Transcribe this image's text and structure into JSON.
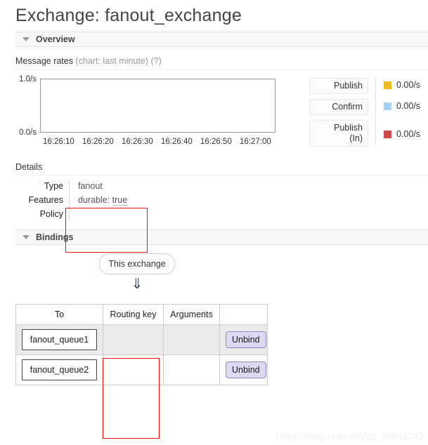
{
  "page": {
    "title": "Exchange: fanout_exchange",
    "watermark": "https://blog.csdn.net/qq_38846242"
  },
  "overview": {
    "heading": "Overview",
    "caret_icon": "caret-down-icon",
    "message_rates_label": "Message rates",
    "message_rates_note": "(chart: last minute)",
    "message_rates_help": "(?)"
  },
  "chart_data": {
    "type": "line",
    "title": "Message rates (chart: last minute)",
    "xlabel": "",
    "ylabel": "",
    "ylim": [
      0.0,
      1.0
    ],
    "ytick_labels": [
      "1.0/s",
      "0.0/s"
    ],
    "ytick_values": [
      1.0,
      0.0
    ],
    "grid": false,
    "x": [
      "16:26:10",
      "16:26:20",
      "16:26:30",
      "16:26:40",
      "16:26:50",
      "16:27:00"
    ],
    "legend_position": "right",
    "series": [
      {
        "name": "Publish",
        "color": "#edbc25",
        "rate": "0.00/s",
        "values": [
          0,
          0,
          0,
          0,
          0,
          0
        ]
      },
      {
        "name": "Confirm",
        "color": "#a5d2f0",
        "rate": "0.00/s",
        "values": [
          0,
          0,
          0,
          0,
          0,
          0
        ]
      },
      {
        "name": "Publish (In)",
        "color": "#cc4b4b",
        "rate": "0.00/s",
        "values": [
          0,
          0,
          0,
          0,
          0,
          0
        ]
      }
    ]
  },
  "rate_buttons": [
    {
      "label": "Publish"
    },
    {
      "label": "Confirm"
    },
    {
      "label": "Publish\n(In)",
      "line1": "Publish",
      "line2": "(In)"
    }
  ],
  "details": {
    "label": "Details",
    "rows": [
      {
        "name": "Type",
        "value": "fanout",
        "underlined": ""
      },
      {
        "name": "Features",
        "value": "durable: ",
        "underlined": "true"
      },
      {
        "name": "Policy",
        "value": "",
        "underlined": ""
      }
    ]
  },
  "bindings": {
    "heading": "Bindings",
    "caret_icon": "caret-down-icon",
    "source_node": "This exchange",
    "arrow_icon": "double-down-arrow-icon",
    "columns": [
      "To",
      "Routing key",
      "Arguments",
      ""
    ],
    "rows": [
      {
        "to": "fanout_queue1",
        "routing_key": "",
        "arguments": "",
        "action": "Unbind"
      },
      {
        "to": "fanout_queue2",
        "routing_key": "",
        "arguments": "",
        "action": "Unbind"
      }
    ]
  },
  "annotations": {
    "details_highlight_color": "#ee1111",
    "routing_key_highlight_color": "#ee1111"
  }
}
